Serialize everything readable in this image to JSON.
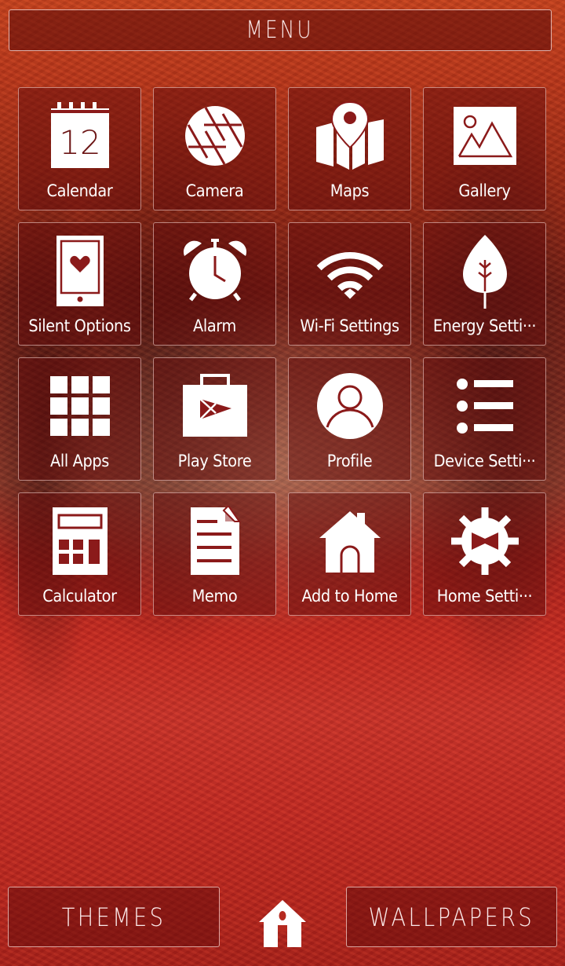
{
  "header": {
    "menu_label": "MENU"
  },
  "colors": {
    "accent": "#8b1a1a",
    "icon_fill": "#ffffff",
    "tile_border": "#f0d8d4"
  },
  "apps": [
    {
      "label": "Calendar",
      "icon": "calendar-icon",
      "calendar_day": "12"
    },
    {
      "label": "Camera",
      "icon": "camera-shutter-icon"
    },
    {
      "label": "Maps",
      "icon": "map-pin-icon"
    },
    {
      "label": "Gallery",
      "icon": "gallery-image-icon"
    },
    {
      "label": "Silent Options",
      "icon": "phone-heart-icon"
    },
    {
      "label": "Alarm",
      "icon": "alarm-clock-icon"
    },
    {
      "label": "Wi-Fi Settings",
      "icon": "wifi-icon"
    },
    {
      "label": "Energy Setti···",
      "icon": "leaf-icon"
    },
    {
      "label": "All Apps",
      "icon": "grid-icon"
    },
    {
      "label": "Play Store",
      "icon": "play-store-bag-icon"
    },
    {
      "label": "Profile",
      "icon": "user-profile-icon"
    },
    {
      "label": "Device Setti···",
      "icon": "list-icon"
    },
    {
      "label": "Calculator",
      "icon": "calculator-icon"
    },
    {
      "label": "Memo",
      "icon": "memo-document-icon"
    },
    {
      "label": "Add to Home",
      "icon": "house-icon"
    },
    {
      "label": "Home Setti···",
      "icon": "gear-bowtie-icon"
    }
  ],
  "footer": {
    "themes_label": "THEMES",
    "wallpapers_label": "WALLPAPERS",
    "home_icon": "home-icon"
  }
}
